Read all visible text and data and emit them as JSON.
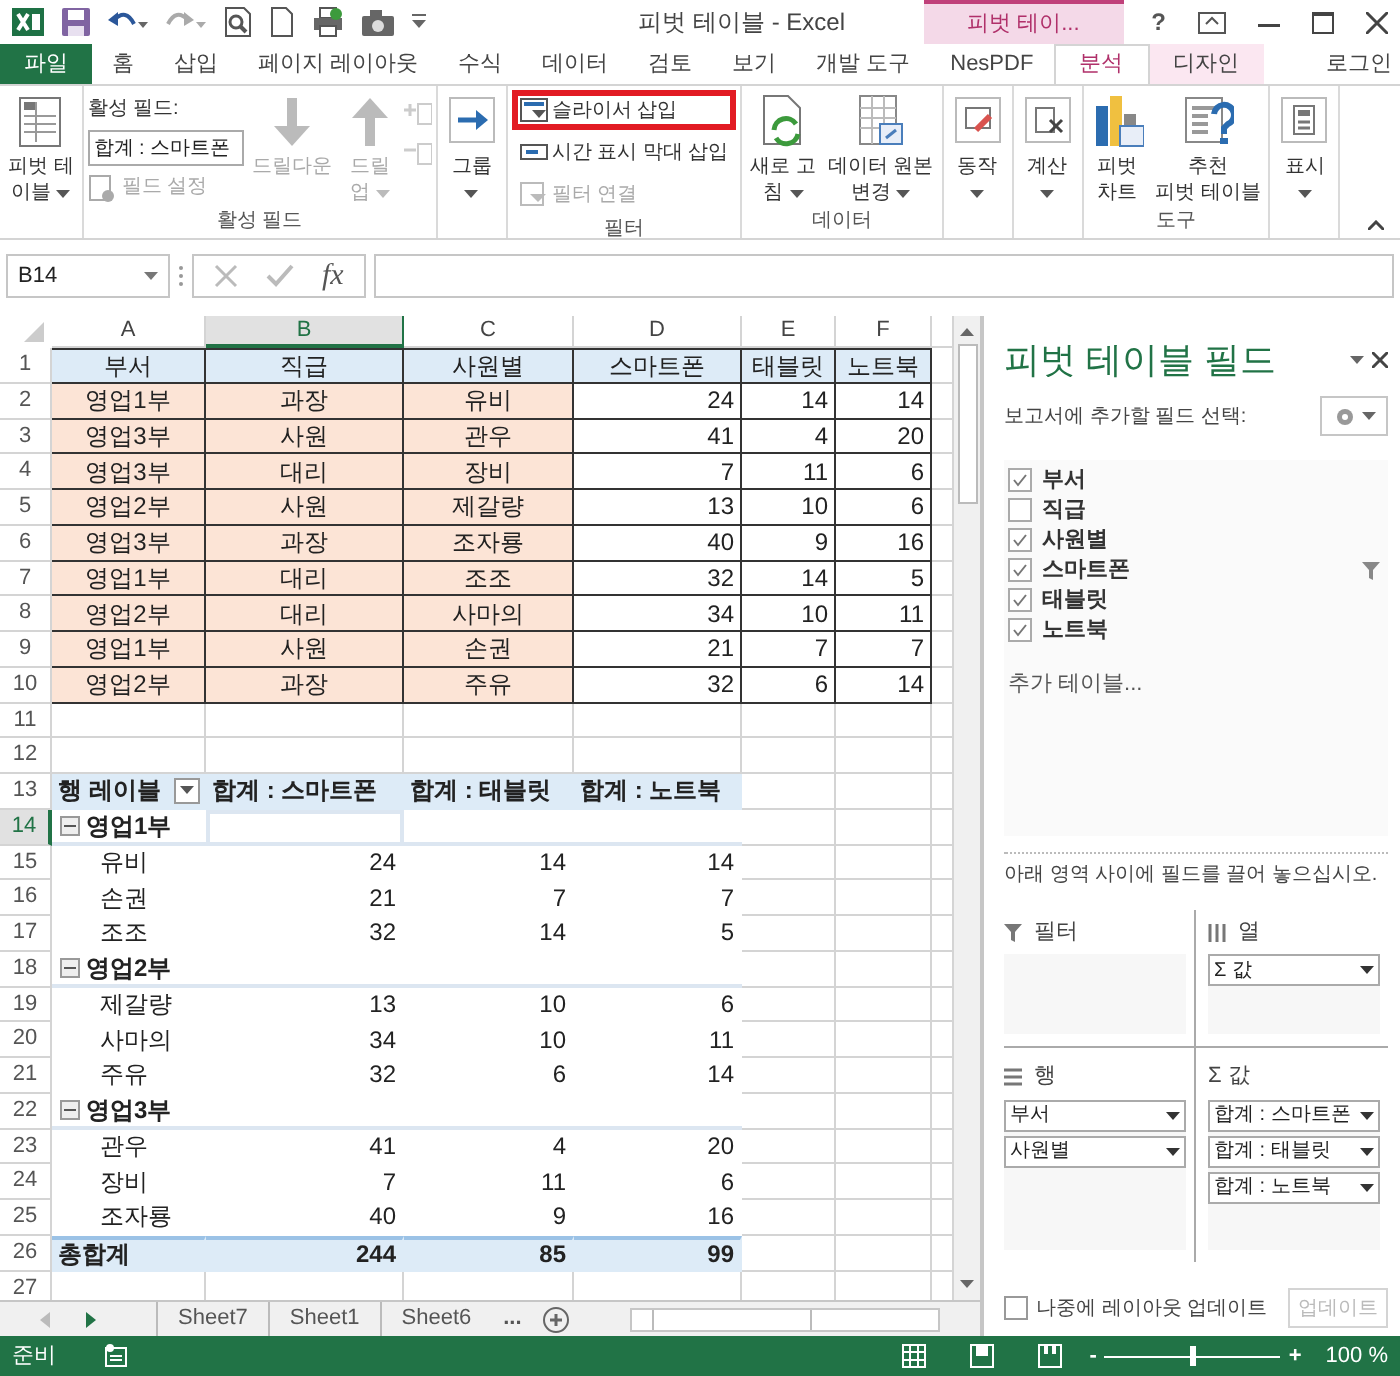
{
  "title_bar": {
    "title": "피벗 테이블 - Excel",
    "context_label": "피벗 테이...",
    "help": "?"
  },
  "ribbon_tabs": [
    {
      "label": "파일",
      "kind": "file",
      "selected": false
    },
    {
      "label": "홈",
      "kind": "tab",
      "selected": false
    },
    {
      "label": "삽입",
      "kind": "tab",
      "selected": false
    },
    {
      "label": "페이지 레이아웃",
      "kind": "tab",
      "selected": false
    },
    {
      "label": "수식",
      "kind": "tab",
      "selected": false
    },
    {
      "label": "데이터",
      "kind": "tab",
      "selected": false
    },
    {
      "label": "검토",
      "kind": "tab",
      "selected": false
    },
    {
      "label": "보기",
      "kind": "tab",
      "selected": false
    },
    {
      "label": "개발 도구",
      "kind": "tab",
      "selected": false
    },
    {
      "label": "NesPDF",
      "kind": "tab",
      "selected": false
    },
    {
      "label": "분석",
      "kind": "context",
      "selected": true
    },
    {
      "label": "디자인",
      "kind": "context",
      "selected": false
    }
  ],
  "account": "로그인",
  "ribbon_groups": [
    {
      "items": [
        {
          "kind": "large",
          "lines": [
            "피벗 테",
            "이블"
          ],
          "dropdown": true,
          "disabled": false
        }
      ]
    },
    {
      "label": "활성 필드",
      "items": [
        {
          "kind": "active_field",
          "caption": "활성 필드:",
          "value": "합계 : 스마트폰",
          "setting": "필드 설정",
          "disabled": true
        },
        {
          "kind": "large",
          "lines": [
            "드릴다운"
          ],
          "dropdown": false,
          "disabled": true
        },
        {
          "kind": "large",
          "lines": [
            "드릴",
            "업"
          ],
          "dropdown": true,
          "disabled": true
        },
        {
          "kind": "expand_pair",
          "disabled": true
        }
      ]
    },
    {
      "items": [
        {
          "kind": "large",
          "lines": [
            "그룹"
          ],
          "dropdown": true,
          "disabled": false
        }
      ]
    },
    {
      "label": "필터",
      "items": [
        {
          "kind": "smalls",
          "buttons": [
            {
              "label": "슬라이서 삽입",
              "highlighted": true,
              "disabled": false
            },
            {
              "label": "시간 표시 막대 삽입",
              "highlighted": false,
              "disabled": false
            },
            {
              "label": "필터 연결",
              "highlighted": false,
              "disabled": true
            }
          ]
        }
      ]
    },
    {
      "label": "데이터",
      "items": [
        {
          "kind": "large",
          "lines": [
            "새로 고",
            "침"
          ],
          "dropdown": true,
          "disabled": false
        },
        {
          "kind": "large",
          "lines": [
            "데이터 원본",
            "변경"
          ],
          "dropdown": true,
          "disabled": false
        }
      ]
    },
    {
      "items": [
        {
          "kind": "large",
          "lines": [
            "동작"
          ],
          "dropdown": true,
          "disabled": false
        }
      ]
    },
    {
      "items": [
        {
          "kind": "large",
          "lines": [
            "계산"
          ],
          "dropdown": true,
          "disabled": false
        }
      ]
    },
    {
      "label": "도구",
      "items": [
        {
          "kind": "large",
          "lines": [
            "피벗",
            "차트"
          ],
          "dropdown": false,
          "disabled": false
        },
        {
          "kind": "large",
          "lines": [
            "추천",
            "피벗 테이블"
          ],
          "dropdown": false,
          "disabled": false
        }
      ]
    },
    {
      "items": [
        {
          "kind": "large",
          "lines": [
            "표시"
          ],
          "dropdown": true,
          "disabled": false
        }
      ]
    }
  ],
  "formula_bar": {
    "name_box": "B14",
    "function_label": "fx"
  },
  "columns": [
    {
      "label": "A",
      "selected": false
    },
    {
      "label": "B",
      "selected": true
    },
    {
      "label": "C",
      "selected": false
    },
    {
      "label": "D",
      "selected": false
    },
    {
      "label": "E",
      "selected": false
    },
    {
      "label": "F",
      "selected": false
    }
  ],
  "rows": [
    {
      "kind": "header",
      "number": "1",
      "selected": false,
      "cells": [
        "부서",
        "직급",
        "사원별",
        "스마트폰",
        "태블릿",
        "노트북"
      ]
    },
    {
      "kind": "data",
      "number": "2",
      "selected": false,
      "cells": [
        "영업1부",
        "과장",
        "유비",
        "24",
        "14",
        "14"
      ]
    },
    {
      "kind": "data",
      "number": "3",
      "selected": false,
      "cells": [
        "영업3부",
        "사원",
        "관우",
        "41",
        "4",
        "20"
      ]
    },
    {
      "kind": "data",
      "number": "4",
      "selected": false,
      "cells": [
        "영업3부",
        "대리",
        "장비",
        "7",
        "11",
        "6"
      ]
    },
    {
      "kind": "data",
      "number": "5",
      "selected": false,
      "cells": [
        "영업2부",
        "사원",
        "제갈량",
        "13",
        "10",
        "6"
      ]
    },
    {
      "kind": "data",
      "number": "6",
      "selected": false,
      "cells": [
        "영업3부",
        "과장",
        "조자룡",
        "40",
        "9",
        "16"
      ]
    },
    {
      "kind": "data",
      "number": "7",
      "selected": false,
      "cells": [
        "영업1부",
        "대리",
        "조조",
        "32",
        "14",
        "5"
      ]
    },
    {
      "kind": "data",
      "number": "8",
      "selected": false,
      "cells": [
        "영업2부",
        "대리",
        "사마의",
        "34",
        "10",
        "11"
      ]
    },
    {
      "kind": "data",
      "number": "9",
      "selected": false,
      "cells": [
        "영업1부",
        "사원",
        "손권",
        "21",
        "7",
        "7"
      ]
    },
    {
      "kind": "data",
      "number": "10",
      "selected": false,
      "cells": [
        "영업2부",
        "과장",
        "주유",
        "32",
        "6",
        "14"
      ]
    },
    {
      "kind": "empty",
      "number": "11",
      "selected": false
    },
    {
      "kind": "empty",
      "number": "12",
      "selected": false
    },
    {
      "kind": "pivot_header",
      "number": "13",
      "selected": false,
      "cells": [
        "행 레이블",
        "합계 : 스마트폰",
        "합계 : 태블릿",
        "합계 : 노트북"
      ]
    },
    {
      "kind": "pivot_group",
      "number": "14",
      "selected": true,
      "label": "영업1부",
      "expanded": true,
      "cursor": true
    },
    {
      "kind": "pivot_item",
      "number": "15",
      "selected": false,
      "cells": [
        "유비",
        "24",
        "14",
        "14"
      ]
    },
    {
      "kind": "pivot_item",
      "number": "16",
      "selected": false,
      "cells": [
        "손권",
        "21",
        "7",
        "7"
      ]
    },
    {
      "kind": "pivot_item",
      "number": "17",
      "selected": false,
      "cells": [
        "조조",
        "32",
        "14",
        "5"
      ]
    },
    {
      "kind": "pivot_group",
      "number": "18",
      "selected": false,
      "label": "영업2부",
      "expanded": true,
      "cursor": false
    },
    {
      "kind": "pivot_item",
      "number": "19",
      "selected": false,
      "cells": [
        "제갈량",
        "13",
        "10",
        "6"
      ]
    },
    {
      "kind": "pivot_item",
      "number": "20",
      "selected": false,
      "cells": [
        "사마의",
        "34",
        "10",
        "11"
      ]
    },
    {
      "kind": "pivot_item",
      "number": "21",
      "selected": false,
      "cells": [
        "주유",
        "32",
        "6",
        "14"
      ]
    },
    {
      "kind": "pivot_group",
      "number": "22",
      "selected": false,
      "label": "영업3부",
      "expanded": true,
      "cursor": false
    },
    {
      "kind": "pivot_item",
      "number": "23",
      "selected": false,
      "cells": [
        "관우",
        "41",
        "4",
        "20"
      ]
    },
    {
      "kind": "pivot_item",
      "number": "24",
      "selected": false,
      "cells": [
        "장비",
        "7",
        "11",
        "6"
      ]
    },
    {
      "kind": "pivot_item",
      "number": "25",
      "selected": false,
      "cells": [
        "조자룡",
        "40",
        "9",
        "16"
      ]
    },
    {
      "kind": "pivot_total",
      "number": "26",
      "selected": false,
      "cells": [
        "총합계",
        "244",
        "85",
        "99"
      ]
    },
    {
      "kind": "empty",
      "number": "27",
      "selected": false
    }
  ],
  "sheet_tabs": [
    {
      "label": "Sheet7",
      "selected": false
    },
    {
      "label": "Sheet1",
      "selected": false
    },
    {
      "label": "Sheet6",
      "selected": false
    }
  ],
  "more_sheets": "...",
  "pivot_panel": {
    "title": "피벗 테이블 필드",
    "prompt": "보고서에 추가할 필드 선택:",
    "fields": [
      {
        "label": "부서",
        "checked": true,
        "filtered": false
      },
      {
        "label": "직급",
        "checked": false,
        "filtered": false
      },
      {
        "label": "사원별",
        "checked": true,
        "filtered": false
      },
      {
        "label": "스마트폰",
        "checked": true,
        "filtered": true
      },
      {
        "label": "태블릿",
        "checked": true,
        "filtered": false
      },
      {
        "label": "노트북",
        "checked": true,
        "filtered": false
      }
    ],
    "more_tables": "추가 테이블...",
    "hint": "아래 영역 사이에 필드를 끌어 놓으십시오.",
    "areas": [
      {
        "label": "필터"
      },
      {
        "label": "열",
        "items": [
          "Σ 값"
        ]
      },
      {
        "label": "행",
        "items": [
          "부서",
          "사원별"
        ]
      },
      {
        "label": "Σ 값",
        "items": [
          "합계 : 스마트폰",
          "합계 : 태블릿",
          "합계 : 노트북"
        ]
      }
    ],
    "defer": {
      "label": "나중에 레이아웃 업데이트",
      "checked": false
    },
    "update_button": {
      "label": "업데이트",
      "disabled": true
    }
  },
  "status_bar": {
    "text": "준비",
    "zoom_out": "-",
    "zoom_in": "+",
    "zoom": "100 %",
    "zoom_slider": {
      "level": 0.5
    }
  }
}
